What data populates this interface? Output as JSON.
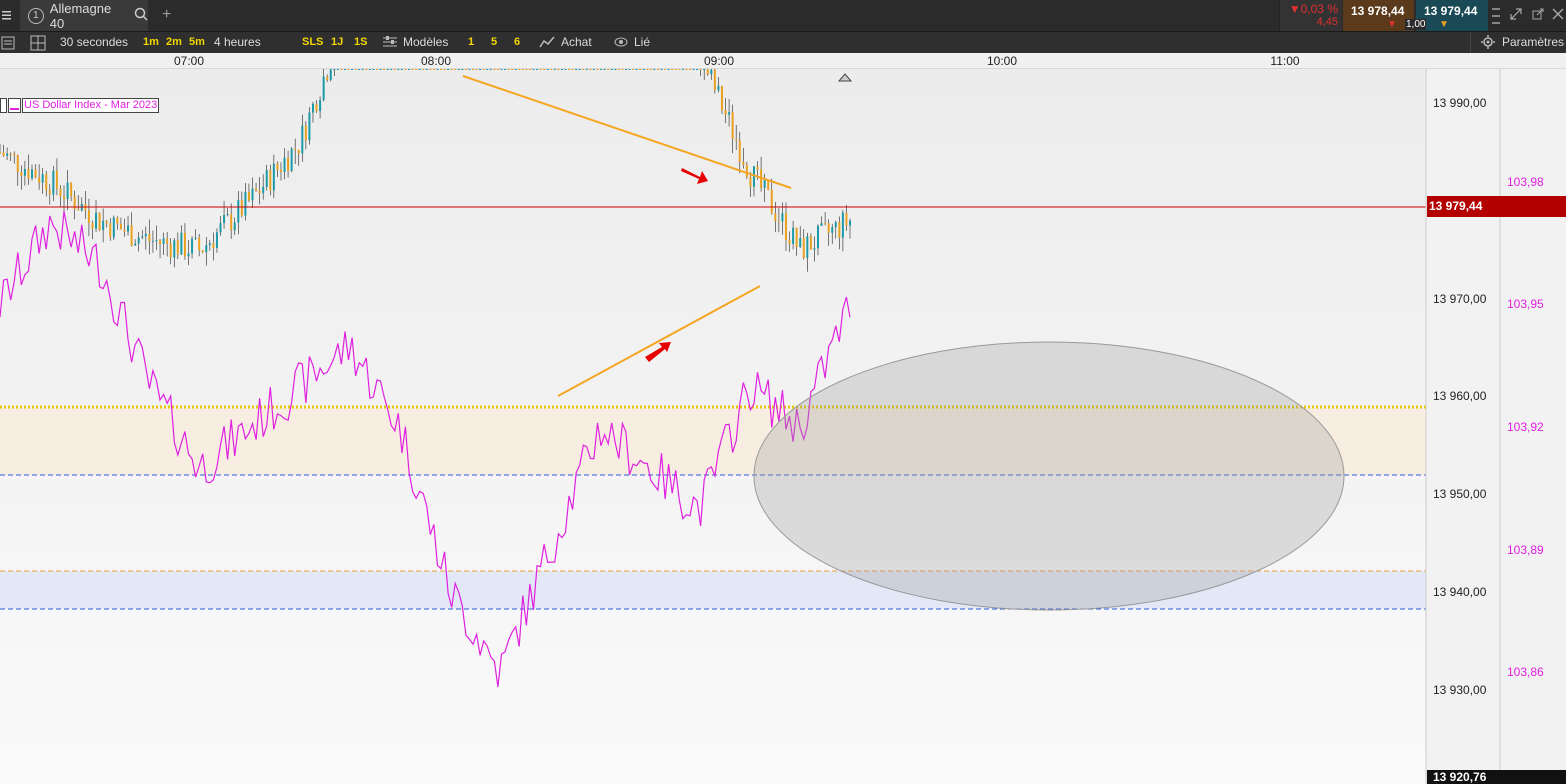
{
  "window": {
    "tab_number": "1",
    "instrument": "Allemagne 40",
    "change_pct": "▼0,03 %",
    "change_abs": "4,45",
    "bid": "13 978,44",
    "ask": "13 979,44",
    "spread": "1,00"
  },
  "toolbar": {
    "interval": "30 secondes",
    "btn_1m": "1m",
    "btn_2m": "2m",
    "btn_5m": "5m",
    "range": "4 heures",
    "btn_sls": "SLS",
    "btn_1j": "1J",
    "btn_1s": "1S",
    "models": "Modèles",
    "btn_1": "1",
    "btn_5": "5",
    "btn_6": "6",
    "achat": "Achat",
    "lie": "Lié",
    "params": "Paramètres"
  },
  "time_axis": [
    "07:00",
    "08:00",
    "09:00",
    "10:00",
    "11:00"
  ],
  "price_axis": [
    "13 990,00",
    "13 970,00",
    "13 960,00",
    "13 950,00",
    "13 940,00",
    "13 930,00",
    "13 920,76"
  ],
  "index_axis": [
    "103,98",
    "103,95",
    "103,92",
    "103,89",
    "103,86"
  ],
  "current_price": "13 979,44",
  "legend": {
    "series": "US Dollar Index - Mar 2023"
  },
  "colors": {
    "candle_up": "#1a9aa8",
    "candle_down": "#e8a020",
    "overlay": "#e020e0",
    "trendline": "#f5a623",
    "price_line": "#cc0000",
    "arrow": "#e60000"
  },
  "chart_data": {
    "type": "line",
    "x": [
      "06:40",
      "06:50",
      "07:00",
      "07:10",
      "07:20",
      "07:30",
      "07:40",
      "07:50",
      "08:00",
      "08:10",
      "08:20",
      "08:30",
      "08:40",
      "08:50",
      "09:00",
      "09:10",
      "09:20",
      "09:30"
    ],
    "series": [
      {
        "name": "",
        "values": [
          13985,
          13982,
          13978,
          13976,
          13975,
          13980,
          13986,
          14000,
          14004,
          14003,
          14002,
          14001,
          13999,
          14000,
          13995,
          13983,
          13975,
          13978
        ]
      },
      {
        "name": "US Dollar Index - Mar 2023",
        "values": [
          103.95,
          103.97,
          103.96,
          103.93,
          103.91,
          103.92,
          103.93,
          103.94,
          103.92,
          103.88,
          103.86,
          103.89,
          103.92,
          103.91,
          103.9,
          103.93,
          103.92,
          103.95
        ]
      }
    ],
    "ylim": [
      13920.76,
      14004
    ],
    "grid": false
  }
}
